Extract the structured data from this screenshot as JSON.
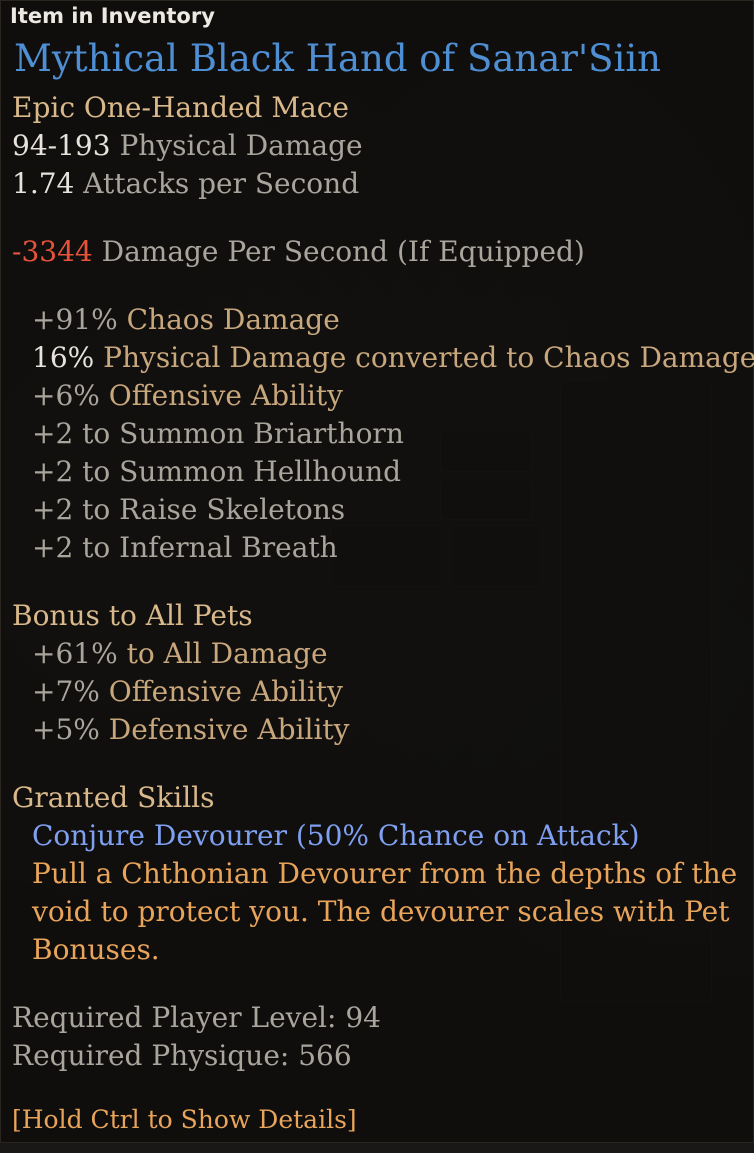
{
  "header": {
    "label": "Item in Inventory"
  },
  "item": {
    "name": "Mythical Black Hand of Sanar'Siin",
    "type": "Epic One-Handed Mace",
    "damage": {
      "value": "94-193",
      "label": "Physical Damage"
    },
    "speed": {
      "value": "1.74",
      "label": "Attacks per Second"
    },
    "dps": {
      "value": "-3344",
      "label": "Damage Per Second (If Equipped)"
    }
  },
  "modifiers": [
    {
      "value": "+91%",
      "label": "Chaos Damage"
    },
    {
      "value": "16%",
      "label": "Physical Damage converted to Chaos Damage"
    },
    {
      "value": "+6%",
      "label": "Offensive Ability"
    },
    {
      "value": "",
      "label": "+2 to Summon Briarthorn"
    },
    {
      "value": "",
      "label": "+2 to Summon Hellhound"
    },
    {
      "value": "",
      "label": "+2 to Raise Skeletons"
    },
    {
      "value": "",
      "label": "+2 to Infernal Breath"
    }
  ],
  "pet_bonus": {
    "heading": "Bonus to All Pets",
    "items": [
      {
        "value": "+61%",
        "label": "to All Damage"
      },
      {
        "value": "+7%",
        "label": "Offensive Ability"
      },
      {
        "value": "+5%",
        "label": "Defensive Ability"
      }
    ]
  },
  "granted": {
    "heading": "Granted Skills",
    "skill": "Conjure Devourer (50% Chance on Attack)",
    "desc_lines": [
      "Pull a Chthonian Devourer from the depths of the",
      "void to protect you. The devourer scales with Pet",
      "Bonuses."
    ]
  },
  "requirements": {
    "level": "Required Player Level: 94",
    "physique": "Required Physique: 566"
  },
  "hint": "[Hold Ctrl to Show Details]",
  "colors": {
    "title": "#4e8fd4",
    "type": "#d9b98b",
    "dps_negative": "#e6533a",
    "skill": "#7f9ff0",
    "description": "#e8a45a"
  }
}
